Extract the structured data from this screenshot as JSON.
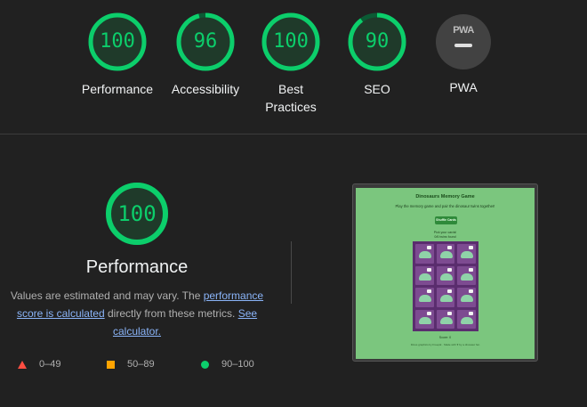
{
  "colors": {
    "pass": "#0cce6b",
    "average": "#ffa400",
    "fail": "#ff4e42",
    "background": "#212121"
  },
  "gauges": [
    {
      "label": "Performance",
      "score": "100",
      "fraction": 1.0
    },
    {
      "label": "Accessibility",
      "score": "96",
      "fraction": 0.96
    },
    {
      "label": "Best Practices",
      "score": "100",
      "fraction": 1.0
    },
    {
      "label": "SEO",
      "score": "90",
      "fraction": 0.9
    }
  ],
  "pwa": {
    "label": "PWA",
    "badge": "PWA"
  },
  "performance": {
    "score": "100",
    "fraction": 1.0,
    "title": "Performance",
    "desc_prefix": "Values are estimated and may vary. The ",
    "link_1": "performance score is calculated",
    "desc_middle": " directly from these metrics. ",
    "link_2": "See calculator."
  },
  "legend": [
    {
      "shape": "triangle",
      "range": "0–49"
    },
    {
      "shape": "square",
      "range": "50–89"
    },
    {
      "shape": "circle",
      "range": "90–100"
    }
  ],
  "screenshot": {
    "title": "Dinosaurs Memory Game",
    "subtitle": "Play the memory game and pair the dinosaur twins together!",
    "button": "Shuffle Cards",
    "pick_line_1": "Pick your cards!",
    "pick_line_2": "0/6 twins found",
    "score": "Score: 0",
    "footer": "Dinos graphics by Freepik · Made with ♥ by a dinosaur fan"
  }
}
